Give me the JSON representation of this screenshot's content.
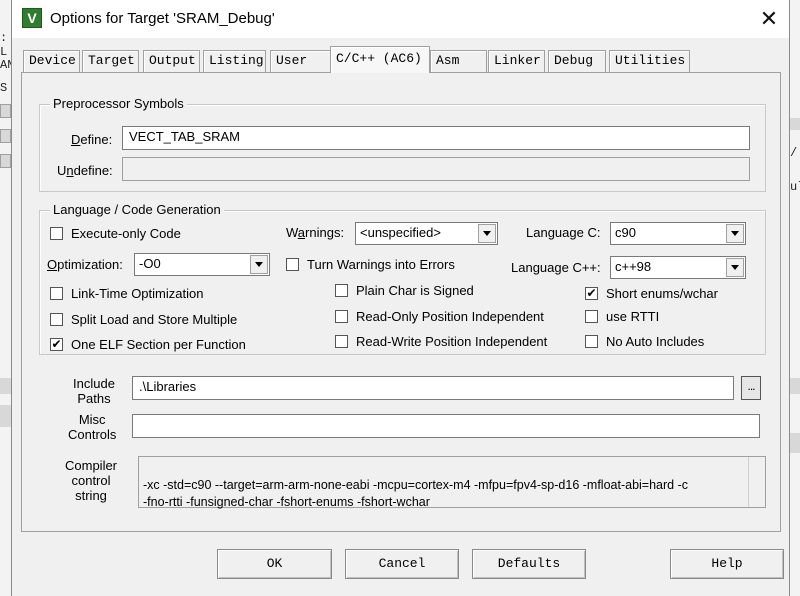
{
  "window": {
    "title": "Options for Target 'SRAM_Debug'",
    "close_glyph": "✕",
    "icon_letter": "V",
    "icon_color": "#2f7d2f"
  },
  "background": {
    "left_fragments": [
      ": L",
      "AN",
      "S"
    ],
    "right_fragments": [
      "/",
      "ul"
    ]
  },
  "tabs": [
    {
      "label": "Device",
      "active": false
    },
    {
      "label": "Target",
      "active": false
    },
    {
      "label": "Output",
      "active": false
    },
    {
      "label": "Listing",
      "active": false
    },
    {
      "label": "User",
      "active": false
    },
    {
      "label": "C/C++ (AC6)",
      "active": true
    },
    {
      "label": "Asm",
      "active": false
    },
    {
      "label": "Linker",
      "active": false
    },
    {
      "label": "Debug",
      "active": false
    },
    {
      "label": "Utilities",
      "active": false
    }
  ],
  "preprocessor": {
    "legend": "Preprocessor Symbols",
    "define_label_key": "D",
    "define_label_rest": "efine:",
    "define_value": "VECT_TAB_SRAM",
    "undefine_label_pre": "U",
    "undefine_label_key": "n",
    "undefine_label_rest": "define:",
    "undefine_value": ""
  },
  "langgen": {
    "legend": "Language / Code Generation",
    "execute_only": {
      "label": "Execute-only Code",
      "checked": false
    },
    "warnings_label_pre": "W",
    "warnings_label_key": "a",
    "warnings_label_rest": "rnings:",
    "warnings_value": "<unspecified>",
    "language_c_label": "Language C:",
    "language_c_value": "c90",
    "optimization_label_key": "O",
    "optimization_label_rest": "ptimization:",
    "optimization_value": "-O0",
    "turn_warnings": {
      "label": "Turn Warnings into Errors",
      "checked": false
    },
    "language_cpp_label": "Language C++:",
    "language_cpp_value": "c++98",
    "link_time": {
      "label": "Link-Time Optimization",
      "checked": false
    },
    "plain_char": {
      "label": "Plain Char is Signed",
      "checked": false
    },
    "short_enums": {
      "label": "Short enums/wchar",
      "checked": true
    },
    "split_load": {
      "label": "Split Load and Store Multiple",
      "checked": false
    },
    "ro_pi": {
      "label": "Read-Only Position Independent",
      "checked": false
    },
    "use_rtti": {
      "label": "use RTTI",
      "checked": false
    },
    "one_elf": {
      "label": "One ELF Section per Function",
      "checked": true
    },
    "rw_pi": {
      "label": "Read-Write Position Independent",
      "checked": false
    },
    "no_auto_includes": {
      "label": "No Auto Includes",
      "checked": false
    }
  },
  "include_paths": {
    "label_line1": "Include",
    "label_line2": "Paths",
    "value": ".\\Libraries",
    "browse_glyph": "..."
  },
  "misc_controls": {
    "label_line1": "Misc",
    "label_line2": "Controls",
    "value": ""
  },
  "compiler_string": {
    "label_line1": "Compiler",
    "label_line2": "control",
    "label_line3": "string",
    "value": "-xc -std=c90 --target=arm-arm-none-eabi -mcpu=cortex-m4 -mfpu=fpv4-sp-d16 -mfloat-abi=hard -c\n-fno-rtti -funsigned-char -fshort-enums -fshort-wchar"
  },
  "buttons": {
    "ok": "OK",
    "cancel": "Cancel",
    "defaults": "Defaults",
    "help": "Help"
  },
  "check_glyph": "✔"
}
